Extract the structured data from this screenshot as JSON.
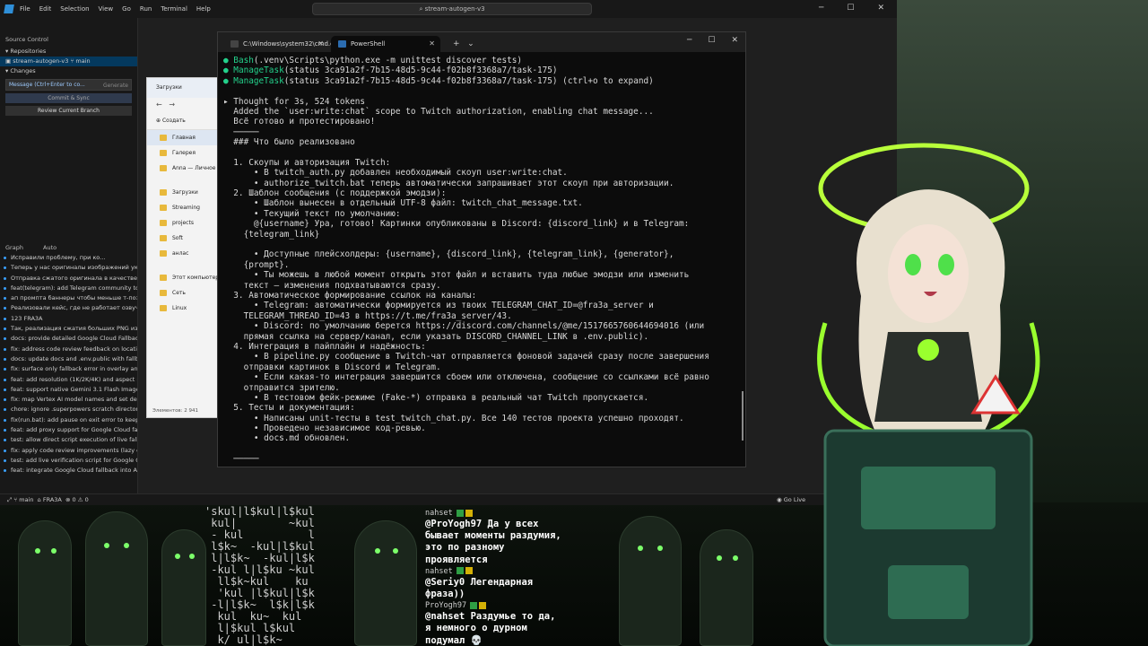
{
  "ide": {
    "menu": [
      "File",
      "Edit",
      "Selection",
      "View",
      "Go",
      "Run",
      "Terminal",
      "Help"
    ],
    "search": "stream-autogen-v3",
    "sidebar": {
      "title": "Source Control",
      "repositories": "Repositories",
      "repo_name": "stream-autogen-v3",
      "branch": "main",
      "changes": "Changes",
      "message_placeholder": "Message (Ctrl+Enter to co...",
      "generate": "Generate",
      "commit_button": "Commit & Sync",
      "review_button": "Review Current Branch",
      "graph_label": "Graph",
      "auto_label": "Auto",
      "commits": [
        "Исправили проблему, при ко...",
        "Теперь у нас оригиналы изображений ук...",
        "Отправка сжатого оригинала в качестве ...",
        "feat(telegram): add Telegram community to...",
        "ап промпта баннеры чтобы меньше т-позы...",
        "Реализовали кейс, где не работает озвучк...",
        "123  FRA3A",
        "Так, реализация сжатия больших PNG изо...",
        "docs: provide detailed Google Cloud Fallbac...",
        "fix: address code review feedback on locatio...",
        "docs: update docs and .env.public with fallb...",
        "fix: surface only fallback error in overlay and...",
        "feat: add resolution (1K/2K/4K) and aspect r...",
        "feat: support native Gemini 3.1 Flash Image ...",
        "fix: map Vertex AI model names and set def...",
        "chore: ignore .superpowers scratch director...",
        "fix(run.bat): add pause on exit error to keep ...",
        "feat: add proxy support for Google Cloud fa...",
        "test: allow direct script execution of live fall...",
        "fix: apply code review improvements (lazy cl...",
        "test: add live verification script for Google C...",
        "feat: integrate Google Cloud fallback into A..."
      ]
    },
    "status": {
      "branch": "main",
      "tag": "FRA3A",
      "counts": "⊗ 0  ⚠ 0",
      "go_live": "Go Live"
    }
  },
  "explorer": {
    "title": "Загрузки",
    "create": "Создать",
    "items": [
      "Главная",
      "Галерея",
      "Anna — Личное",
      "Загрузки",
      "Streaming",
      "projects",
      "Soft",
      "анлас",
      "Этот компьютер",
      "Сеть",
      "Linux"
    ],
    "status": "Элементов: 2 941"
  },
  "terminal": {
    "tab1": "C:\\Windows\\system32\\cmd.exe",
    "tab2": "PowerShell",
    "lines": [
      {
        "p": "● ",
        "g": "Bash",
        "t": "(.venv\\Scripts\\python.exe -m unittest discover tests)"
      },
      {
        "p": "● ",
        "g": "ManageTask",
        "t": "(status 3ca91a2f-7b15-48d5-9c44-f02b8f3368a7/task-175)"
      },
      {
        "p": "● ",
        "g": "ManageTask",
        "t": "(status 3ca91a2f-7b15-48d5-9c44-f02b8f3368a7/task-175) (ctrl+o to expand)"
      },
      {
        "t": ""
      },
      {
        "t": "▸ Thought for 3s, 524 tokens"
      },
      {
        "t": "  Added the `user:write:chat` scope to Twitch authorization, enabling chat message..."
      },
      {
        "t": "  Всё готово и протестировано!"
      },
      {
        "t": "  ─────"
      },
      {
        "t": "  ### Что было реализовано"
      },
      {
        "t": ""
      },
      {
        "t": "  1. Скоупы и авторизация Twitch:"
      },
      {
        "t": "      • В twitch_auth.py добавлен необходимый скоуп user:write:chat."
      },
      {
        "t": "      • authorize_twitch.bat теперь автоматически запрашивает этот скоуп при авторизации."
      },
      {
        "t": "  2. Шаблон сообщения (с поддержкой эмодзи):"
      },
      {
        "t": "      • Шаблон вынесен в отдельный UTF-8 файл: twitch_chat_message.txt."
      },
      {
        "t": "      • Текущий текст по умолчанию:"
      },
      {
        "t": "      @{username} Ура, готово! Картинки опубликованы в Discord: {discord_link} и в Telegram:"
      },
      {
        "t": "    {telegram_link}"
      },
      {
        "t": ""
      },
      {
        "t": "      • Доступные плейсхолдеры: {username}, {discord_link}, {telegram_link}, {generator},"
      },
      {
        "t": "    {prompt}."
      },
      {
        "t": "      • Ты можешь в любой момент открыть этот файл и вставить туда любые эмодзи или изменить"
      },
      {
        "t": "    текст — изменения подхватываются сразу."
      },
      {
        "t": "  3. Автоматическое формирование ссылок на каналы:"
      },
      {
        "t": "      • Telegram: автоматически формируется из твоих TELEGRAM_CHAT_ID=@fra3a_server и"
      },
      {
        "t": "    TELEGRAM_THREAD_ID=43 в https://t.me/fra3a_server/43."
      },
      {
        "t": "      • Discord: по умолчанию берется https://discord.com/channels/@me/1517665760644694016 (или"
      },
      {
        "t": "    прямая ссылка на сервер/канал, если указать DISCORD_CHANNEL_LINK в .env.public)."
      },
      {
        "t": "  4. Интеграция в пайплайн и надёжность:"
      },
      {
        "t": "      • В pipeline.py сообщение в Twitch-чат отправляется фоновой задачей сразу после завершения"
      },
      {
        "t": "    отправки картинок в Discord и Telegram."
      },
      {
        "t": "      • Если какая-то интеграция завершится сбоем или отключена, сообщение со ссылками всё равно"
      },
      {
        "t": "    отправится зрителю."
      },
      {
        "t": "      • В тестовом фейк-режиме (Fake-*) отправка в реальный чат Twitch пропускается."
      },
      {
        "t": "  5. Тесты и документация:"
      },
      {
        "t": "      • Написаны unit-тесты в test_twitch_chat.py. Все 140 тестов проекта успешно проходят."
      },
      {
        "t": "      • Проведено независимое код-ревью."
      },
      {
        "t": "      • docs.md обновлен."
      },
      {
        "t": ""
      },
      {
        "t": "  ─────"
      }
    ]
  },
  "chat": {
    "messages": [
      {
        "user": "nahset",
        "lines": [
          "@ProYogh97 Да у всех",
          "бывает моменты раздумия,",
          "это по разному",
          "проявляется"
        ]
      },
      {
        "user": "nahset",
        "lines": [
          "@Seriy0 Легендарная",
          "фраза))"
        ]
      },
      {
        "user": "ProYogh97",
        "lines": [
          "@nahset Раздумье то да,",
          "я немного о дурном",
          "подумал 💀"
        ]
      }
    ]
  },
  "ascii": "'skul|l$kul|l$kul\n kul|        ~kul\n - kul          l\n l$k~  -kul|l$kul\n l|l$k~  -kul|l$k\n -kul l|l$ku ~kul\n  ll$k~kul    ku\n  'kul |l$kul|l$k\n -l|l$k~  l$k|l$k\n  kul  ku~  kul\n  l|$kul l$kul\n  k/ ul|l$k~\n kul~ kul|\n  ku-/l$k\n  kul|l$k~\n  k~l|l"
}
